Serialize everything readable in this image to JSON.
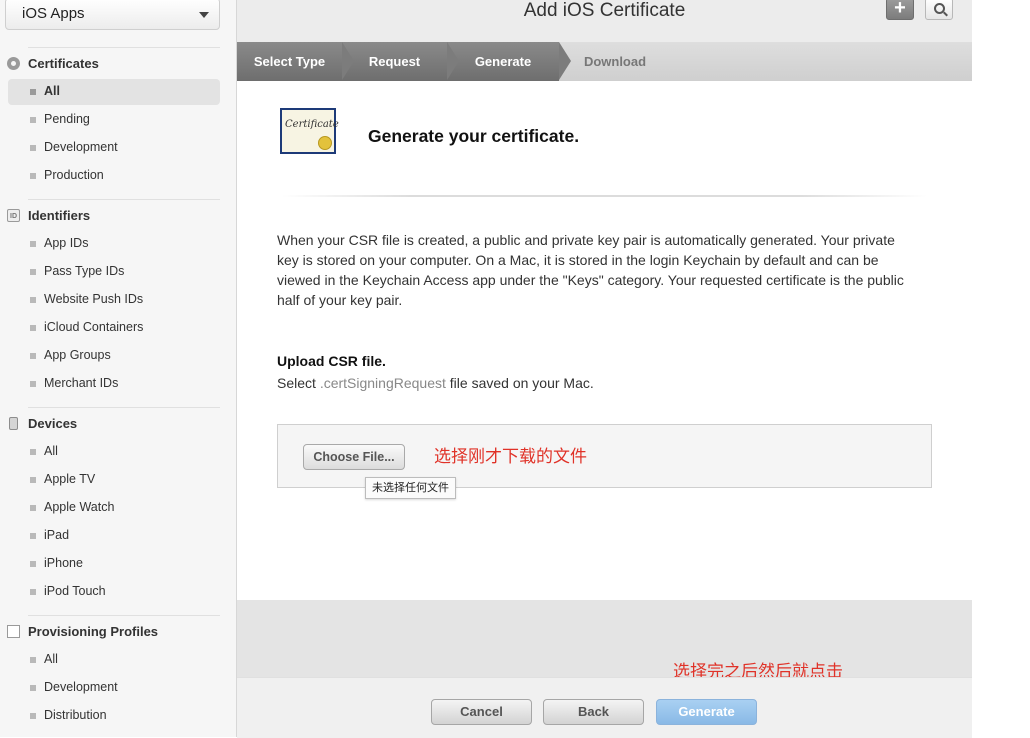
{
  "sidebar": {
    "app_select": "iOS Apps",
    "sections": [
      {
        "label": "Certificates",
        "icon": "gear-icon",
        "items": [
          {
            "label": "All",
            "active": true
          },
          {
            "label": "Pending"
          },
          {
            "label": "Development"
          },
          {
            "label": "Production"
          }
        ]
      },
      {
        "label": "Identifiers",
        "icon": "id-icon",
        "icon_text": "ID",
        "items": [
          {
            "label": "App IDs"
          },
          {
            "label": "Pass Type IDs"
          },
          {
            "label": "Website Push IDs"
          },
          {
            "label": "iCloud Containers"
          },
          {
            "label": "App Groups"
          },
          {
            "label": "Merchant IDs"
          }
        ]
      },
      {
        "label": "Devices",
        "icon": "device-icon",
        "items": [
          {
            "label": "All"
          },
          {
            "label": "Apple TV"
          },
          {
            "label": "Apple Watch"
          },
          {
            "label": "iPad"
          },
          {
            "label": "iPhone"
          },
          {
            "label": "iPod Touch"
          }
        ]
      },
      {
        "label": "Provisioning Profiles",
        "icon": "document-icon",
        "items": [
          {
            "label": "All"
          },
          {
            "label": "Development"
          },
          {
            "label": "Distribution"
          }
        ]
      }
    ]
  },
  "header": {
    "title": "Add iOS Certificate",
    "plus_symbol": "+"
  },
  "steps": [
    "Select Type",
    "Request",
    "Generate",
    "Download"
  ],
  "content": {
    "cert_image_text": "Certificate",
    "title": "Generate your certificate.",
    "description": "When your CSR file is created, a public and private key pair is automatically generated. Your private key is stored on your computer. On a Mac, it is stored in the login Keychain by default and can be viewed in the Keychain Access app under the \"Keys\" category. Your requested certificate is the public half of your key pair.",
    "upload_title": "Upload CSR file.",
    "upload_hint_pre": "Select ",
    "upload_hint_ext": ".certSigningRequest",
    "upload_hint_post": " file saved on your Mac.",
    "choose_button": "Choose File...",
    "annotation_choose": "选择刚才下载的文件",
    "no_file_tooltip": "未选择任何文件"
  },
  "footer": {
    "annotation_generate": "选择完之后然后就点击",
    "cancel": "Cancel",
    "back": "Back",
    "generate": "Generate"
  },
  "colors": {
    "annotation": "#e03228",
    "generate_button": "#99c4ec",
    "step_done": "#7c7c7c"
  }
}
